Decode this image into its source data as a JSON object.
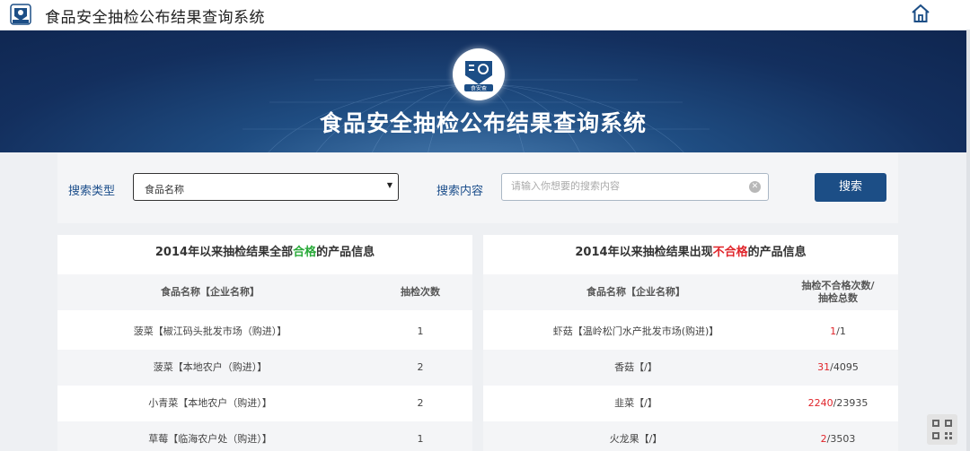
{
  "header": {
    "title": "食品安全抽检公布结果查询系统"
  },
  "hero": {
    "title": "食品安全抽检公布结果查询系统",
    "logo_text": "食安查"
  },
  "search": {
    "type_label": "搜索类型",
    "type_value": "食品名称",
    "content_label": "搜索内容",
    "content_placeholder": "请输入你想要的搜索内容",
    "button": "搜索"
  },
  "left_panel": {
    "title_pre": "2014年以来抽检结果全部",
    "title_hl": "合格",
    "title_post": "的产品信息",
    "col1": "食品名称【企业名称】",
    "col2": "抽检次数",
    "rows": [
      {
        "name": "菠菜【椒江码头批发市场（购进）】",
        "count": "1"
      },
      {
        "name": "菠菜【本地农户（购进）】",
        "count": "2"
      },
      {
        "name": "小青菜【本地农户（购进）】",
        "count": "2"
      },
      {
        "name": "草莓【临海农户处（购进）】",
        "count": "1"
      }
    ]
  },
  "right_panel": {
    "title_pre": "2014年以来抽检结果出现",
    "title_hl": "不合格",
    "title_post": "的产品信息",
    "col1": "食品名称【企业名称】",
    "col2_line1": "抽检不合格次数/",
    "col2_line2": "抽检总数",
    "rows": [
      {
        "name": "虾菇【温岭松门水产批发市场(购进)】",
        "fail": "1",
        "total": "/1"
      },
      {
        "name": "香菇【/】",
        "fail": "31",
        "total": "/4095"
      },
      {
        "name": "韭菜【/】",
        "fail": "2240",
        "total": "/23935"
      },
      {
        "name": "火龙果【/】",
        "fail": "2",
        "total": "/3503"
      }
    ]
  },
  "colors": {
    "brand": "#1c4e86",
    "pass": "#2aaa3a",
    "fail": "#e0252b"
  },
  "icons": [
    "app-logo-icon",
    "home-icon",
    "clear-icon",
    "qr-code-icon"
  ]
}
